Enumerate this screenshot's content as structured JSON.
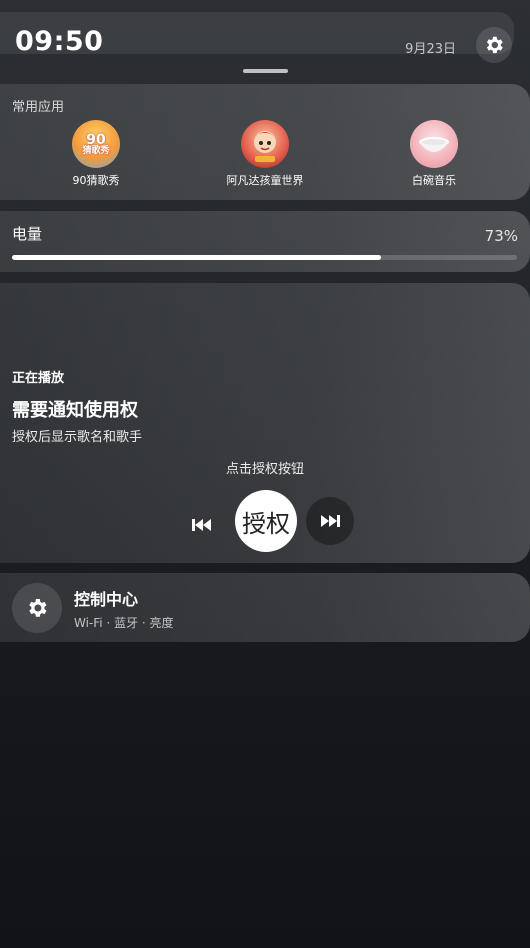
{
  "status": {
    "time": "09:50",
    "date": "9月23日",
    "settings_icon": "gear-icon"
  },
  "apps": {
    "title": "常用应用",
    "items": [
      {
        "label": "90猜歌秀",
        "badge_number": "90",
        "badge_text": "猜歌秀",
        "icon": "music-guess-app-icon",
        "color": "#e07a3a"
      },
      {
        "label": "阿凡达孩童世界",
        "icon": "avatar-kids-world-app-icon",
        "color": "#c94a3a"
      },
      {
        "label": "白碗音乐",
        "icon": "white-bowl-music-app-icon",
        "color": "#f0a8b0"
      }
    ]
  },
  "battery": {
    "label": "电量",
    "value": "73%",
    "level_percent": 73
  },
  "media": {
    "now_playing": "正在播放",
    "title": "需要通知使用权",
    "subtitle": "授权后显示歌名和歌手",
    "hint": "点击授权按钮",
    "main_button": "授权",
    "prev_icon": "skip-previous-icon",
    "next_icon": "skip-next-icon"
  },
  "control_center": {
    "title": "控制中心",
    "subtitle": "Wi-Fi · 蓝牙 · 亮度",
    "icon": "gear-icon"
  }
}
